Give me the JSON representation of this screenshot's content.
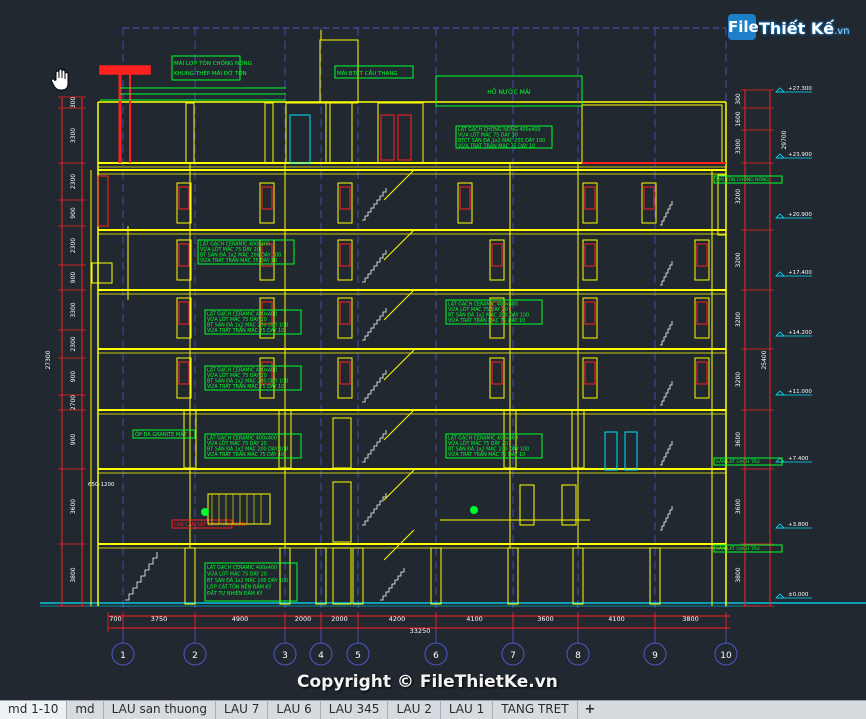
{
  "watermark": {
    "badge": "File",
    "brand": "Thiết Kế",
    "domain": ".vn"
  },
  "copyright": "Copyright © FileThietKe.vn",
  "tabs": [
    "md 1-10",
    "md",
    "LAU san thuong",
    "LAU 7",
    "LAU 6",
    "LAU 345",
    "LAU 2",
    "LAU 1",
    "TANG TRET"
  ],
  "tab_add": "+",
  "drawing": {
    "grid_labels": [
      "1",
      "2",
      "3",
      "4",
      "5",
      "6",
      "7",
      "8",
      "9",
      "10"
    ],
    "span_dims": [
      "700",
      "3750",
      "4900",
      "2000",
      "2000",
      "4200",
      "4100",
      "3600",
      "4100",
      "3800"
    ],
    "total_dim": "33250",
    "left_dims": [
      "300",
      "3300",
      "2300",
      "900",
      "2300",
      "900",
      "3300",
      "2300",
      "900",
      "2700",
      "900",
      "3600",
      "3800"
    ],
    "left_total": "27300",
    "right_dims": [
      "300",
      "1600",
      "3300",
      "3200",
      "3200",
      "3200",
      "3200",
      "3600",
      "3600",
      "3800"
    ],
    "right_totals": [
      "25400",
      "29700"
    ],
    "levels": [
      "+27.300",
      "+23.900",
      "+20.900",
      "+17.400",
      "+14.200",
      "+11.000",
      "+7.400",
      "+3.800",
      "±0.000"
    ],
    "roof_note_1": "MÁI LỢP TÔN CHỐNG NÓNG",
    "roof_note_2": "KHUNG THÉP MÁI ĐỠ TÔN",
    "stair_roof_note": "MÁI BTCT CẦU THANG",
    "water_tank": "HỒ NƯỚC MÁI",
    "roof_slab_1": "LÁT GẠCH CHỐNG NÓNG 400x400",
    "roof_slab_2": "VỮA LÓT MÁC 75 DÀY 30",
    "roof_slab_3": "BTCT SÀN ĐÁ 1x2 MÁC 250 DÀY 100",
    "roof_slab_4": "VỮA TRÁT TRẦN MÁC 75 DÀY 10",
    "floor_1": "LÁT GẠCH CERAMIC 400x400",
    "floor_2": "VỮA LÓT MÁC 75 DÀY 20",
    "floor_3": "BT SÀN ĐÁ 1x2 MÁC 200 DÀY 100",
    "floor_4": "VỮA TRÁT TRẦN MÁC 75 DÀY 10",
    "ground_1": "LÁT GẠCH CERAMIC 400x400",
    "ground_2": "VỮA LÓT MÁC 75 DÀY 20",
    "ground_3": "BT SÀN ĐÁ 1x2 MÁC 100 DÀY 100",
    "ground_4": "LỚP CÁT TÔN NỀN ĐẦM KỸ",
    "ground_5": "ĐẤT TỰ NHIÊN ĐẦM KỸ",
    "balcony_note": "ỐP ĐÁ GRANITE MẶT",
    "left_ann": "650-1200",
    "stair_note": "LAN CAN SẮT SƠN TĨNH ĐIỆN",
    "right_level_top": "MÁI TÔN CHỐNG NÓNG",
    "right_level_mid": "SÂN LÁT GẠCH TÀU",
    "right_level_bottom": "SÂN LÁT GẠCH TÀU"
  },
  "colors": {
    "background": "#212830",
    "yellow": "#ffff00",
    "green": "#00ff2a",
    "red": "#ff2020",
    "cyan": "#00e5ff",
    "white": "#ffffff",
    "grid": "#4b58c8"
  }
}
